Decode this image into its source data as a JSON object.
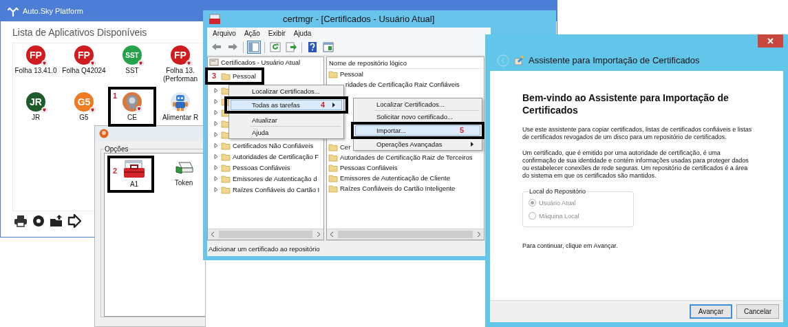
{
  "launcher": {
    "title": "Auto.Sky Platform",
    "heading": "Lista de Aplicativos Disponíveis",
    "apps": [
      {
        "label": "Folha 13.41.0",
        "kind": "badge",
        "badge": "FP",
        "color": "#d01c1f"
      },
      {
        "label": "Folha Q42024",
        "kind": "badge",
        "badge": "FP",
        "color": "#d01c1f"
      },
      {
        "label": "SST",
        "kind": "badge",
        "badge": "SST",
        "color": "#25a24a"
      },
      {
        "label": "Folha 13.\n(Performan",
        "kind": "badge",
        "badge": "FP",
        "color": "#d01c1f"
      },
      {
        "label": "JR",
        "kind": "badge",
        "badge": "JR",
        "color": "#1e5b2b"
      },
      {
        "label": "G5",
        "kind": "badge",
        "badge": "G5",
        "color": "#f07b22"
      },
      {
        "label": "CE",
        "kind": "seal"
      },
      {
        "label": "Alimentar R",
        "kind": "robot"
      }
    ],
    "tools": [
      {
        "kind": "printer"
      },
      {
        "kind": "settings"
      },
      {
        "kind": "upload"
      },
      {
        "kind": "exit"
      }
    ]
  },
  "options_window": {
    "group": "Opções",
    "items": [
      {
        "label": "A1",
        "kind": "toolbox"
      },
      {
        "label": "Token",
        "kind": "token"
      }
    ]
  },
  "certmgr": {
    "title": "certmgr - [Certificados - Usuário Atual]",
    "menu": [
      "Arquivo",
      "Ação",
      "Exibir",
      "Ajuda"
    ],
    "toolbar": [
      {
        "kind": "back",
        "selected": false
      },
      {
        "kind": "forward",
        "selected": false
      },
      {
        "kind": "separator"
      },
      {
        "kind": "tree",
        "selected": true
      },
      {
        "kind": "separator"
      },
      {
        "kind": "refresh",
        "selected": false
      },
      {
        "kind": "export",
        "selected": false
      },
      {
        "kind": "separator"
      },
      {
        "kind": "help",
        "selected": false
      },
      {
        "kind": "pane",
        "selected": false
      }
    ],
    "tree": {
      "label": "Certificados - Usuário Atual",
      "children": [
        {
          "label": "Pessoal",
          "expandable": false
        },
        {
          "expandable": true
        },
        {
          "expandable": true
        },
        {
          "expandable": true
        },
        {
          "expandable": true
        },
        {
          "expandable": true
        },
        {
          "label": "Certificados Não Confiáveis",
          "expandable": true
        },
        {
          "label": "Autoridades de Certificação F",
          "expandable": true
        },
        {
          "label": "Pessoas Confiáveis",
          "expandable": true
        },
        {
          "label": "Emissores de Autenticação d",
          "expandable": true
        },
        {
          "label": "Raízes Confiáveis do Cartão I",
          "expandable": true
        }
      ]
    },
    "list": {
      "column": "Nome de repositório lógico",
      "rows": [
        {
          "label": "Pessoal",
          "kind": "folder"
        },
        {
          "label": "ridades de Certificação Raiz Confiáveis",
          "kind": "cut"
        }
      ],
      "rows_below": [
        {
          "label": "Cer",
          "kind": "folder"
        },
        {
          "label": "Autoridades de Certificação Raiz de Terceiros",
          "kind": "folder"
        },
        {
          "label": "Pessoas Confiáveis",
          "kind": "folder"
        },
        {
          "label": "Emissores de Autenticação de Cliente",
          "kind": "folder"
        },
        {
          "label": "Raízes Confiáveis do Cartão Inteligente",
          "kind": "folder"
        }
      ]
    },
    "status_bar": "Adicionar um certificado ao repositório",
    "context_menu": [
      {
        "kind": "item",
        "label": "Localizar Certificados...",
        "selected": false,
        "submenu": false
      },
      {
        "kind": "item",
        "label": "Todas as tarefas",
        "selected": true,
        "submenu": true
      },
      {
        "kind": "separator"
      },
      {
        "kind": "item",
        "label": "Atualizar",
        "selected": false,
        "submenu": false
      },
      {
        "kind": "separator"
      },
      {
        "kind": "item",
        "label": "Ajuda",
        "selected": false,
        "submenu": false
      }
    ],
    "submenu": [
      {
        "kind": "item",
        "label": "Localizar Certificados...",
        "selected": false,
        "submenu": false
      },
      {
        "kind": "separator"
      },
      {
        "kind": "item",
        "label": "Solicitar novo certificado...",
        "selected": false,
        "submenu": false
      },
      {
        "kind": "item",
        "label": "Importar...",
        "selected": true,
        "submenu": false
      },
      {
        "kind": "item",
        "label": "Operações Avançadas",
        "selected": false,
        "submenu": true
      }
    ]
  },
  "wizard": {
    "title": "Assistente para Importação de Certificados",
    "heading": "Bem-vindo ao Assistente para Importação de Certificados",
    "paragraphs": [
      "Use este assistente para copiar certificados, listas de certificados confiáveis e listas de certificados revogados de um disco para um repositório de certificados.",
      "Um certificado, que é emitido por uma autoridade de certificação, é uma confirmação de sua identidade e contém informações usadas para proteger dados ou estabelecer conexões de rede seguras. Um repositório de certificados é a área do sistema em que os certificados são mantidos."
    ],
    "group": {
      "label": "Local do Repositório",
      "disabled": true,
      "options": [
        {
          "label": "Usuário Atual",
          "selected": true
        },
        {
          "label": "Máquina Local",
          "selected": false
        }
      ]
    },
    "footer_text": "Para continuar, clique em Avançar.",
    "buttons": [
      {
        "label": "Avançar",
        "default": true
      },
      {
        "label": "Cancelar",
        "default": false
      }
    ]
  },
  "callouts": [
    {
      "number": "1"
    },
    {
      "number": "2"
    },
    {
      "number": "3"
    },
    {
      "number": "4"
    },
    {
      "number": "5"
    }
  ]
}
